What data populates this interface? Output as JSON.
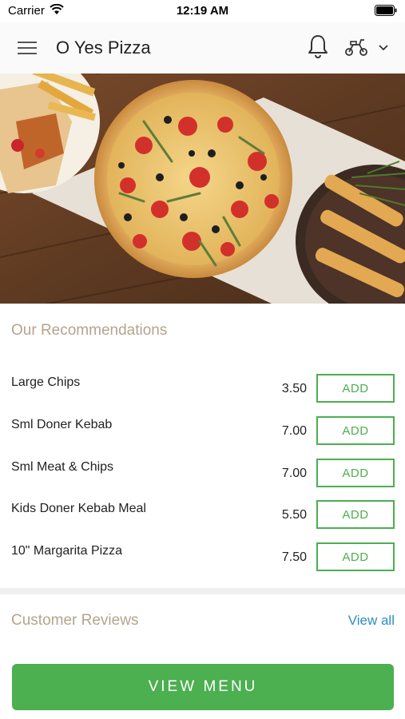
{
  "status_bar": {
    "carrier": "Carrier",
    "time": "12:19 AM"
  },
  "header": {
    "title": "O Yes Pizza",
    "icons": [
      "hamburger-menu-icon",
      "bell-icon",
      "scooter-icon",
      "chevron-down-icon"
    ]
  },
  "hero": {
    "icon": "food-photo"
  },
  "recommendations": {
    "title": "Our Recommendations",
    "items": [
      {
        "name": "Large Chips",
        "price": "3.50",
        "button": "ADD"
      },
      {
        "name": "Sml Doner Kebab",
        "price": "7.00",
        "button": "ADD"
      },
      {
        "name": "Sml Meat & Chips",
        "price": "7.00",
        "button": "ADD"
      },
      {
        "name": "Kids Doner Kebab Meal",
        "price": "5.50",
        "button": "ADD"
      },
      {
        "name": "10\" Margarita Pizza",
        "price": "7.50",
        "button": "ADD"
      }
    ]
  },
  "reviews": {
    "title": "Customer Reviews",
    "view_all": "View all"
  },
  "footer": {
    "button": "VIEW MENU"
  },
  "colors": {
    "accent_green": "#4caf50",
    "section_title": "#b3a58c",
    "link_blue": "#2a8fc0"
  }
}
